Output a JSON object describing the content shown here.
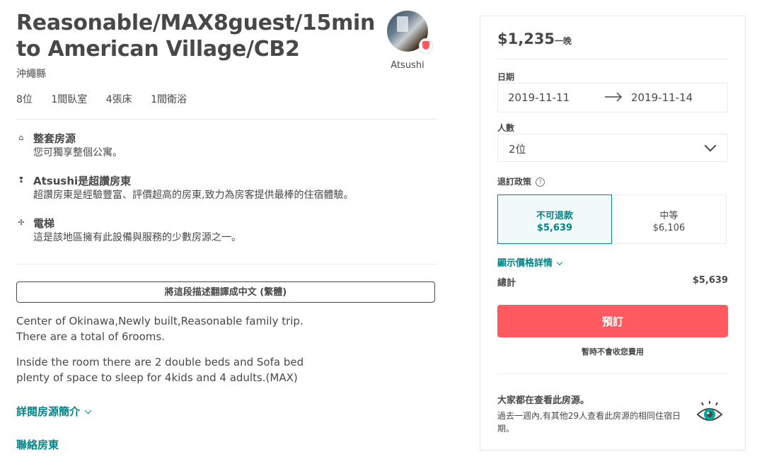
{
  "listing": {
    "title": "Reasonable/MAX8guest/15min to American Village/CB2",
    "location": "沖繩縣",
    "host_name": "Atsushi",
    "stats": [
      "8位",
      "1間臥室",
      "4張床",
      "1間衛浴"
    ]
  },
  "highlights": [
    {
      "icon": "home-icon",
      "glyph": "⌂",
      "title": "整套房源",
      "desc": "您可獨享整個公寓。"
    },
    {
      "icon": "superhost-medal-icon",
      "glyph": "❢",
      "title": "Atsushi是超讚房東",
      "desc": "超讚房東是經驗豐富、評價超高的房東,致力為房客提供最棒的住宿體驗。"
    },
    {
      "icon": "sparkle-icon",
      "glyph": "✢",
      "title": "電梯",
      "desc": "這是該地區擁有此設備與服務的少數房源之一。"
    }
  ],
  "translate_button": "將這段描述翻譯成中文 (繁體)",
  "description": {
    "para1_line1": "Center of Okinawa,Newly built,Reasonable family trip.",
    "para1_line2": "There are a total of 6rooms.",
    "para2_line1": "Inside the room there are 2 double beds and Sofa bed",
    "para2_line2": "plenty of space to sleep for 4kids and 4 adults.(MAX)"
  },
  "links": {
    "read_more": "詳閱房源簡介",
    "contact_host": "聯絡房東"
  },
  "booking": {
    "price": "$1,235",
    "per_night": "一晚",
    "dates_label": "日期",
    "check_in": "2019-11-11",
    "check_out": "2019-11-14",
    "guests_label": "人數",
    "guests_value": "2位",
    "cancellation_label": "退訂政策",
    "policies": [
      {
        "name": "不可退款",
        "price": "$5,639",
        "selected": true
      },
      {
        "name": "中等",
        "price": "$6,106",
        "selected": false
      }
    ],
    "show_price_details": "顯示價格詳情",
    "total_label": "總計",
    "total_value": "$5,639",
    "book_button": "預訂",
    "no_charge_note": "暫時不會收您費用",
    "popularity_title": "大家都在查看此房源。",
    "popularity_desc": "過去一週內,有其他29人查看此房源的相同住宿日期。"
  },
  "colors": {
    "accent_teal": "#008489",
    "book_red": "#ff5a5f",
    "text": "#484848"
  }
}
